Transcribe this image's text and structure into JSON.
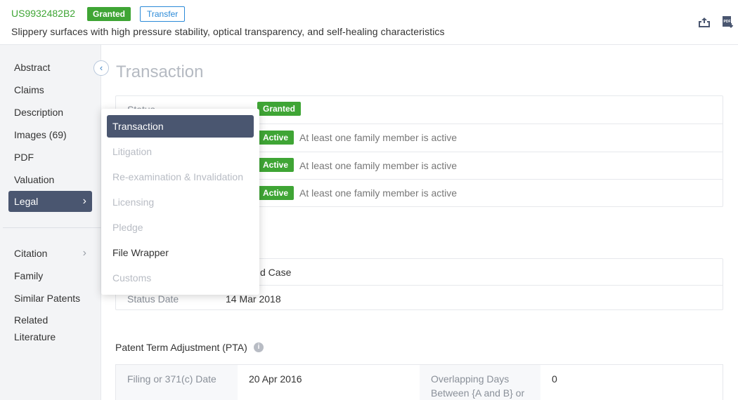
{
  "header": {
    "patent_number": "US9932482B2",
    "status_badge": "Granted",
    "transfer_badge": "Transfer",
    "title": "Slippery surfaces with high pressure stability, optical transparency, and self-healing characteristics",
    "icons": [
      "export-icon",
      "pdf-download-icon"
    ]
  },
  "sidebar": {
    "items": [
      {
        "label": "Abstract"
      },
      {
        "label": "Claims"
      },
      {
        "label": "Description"
      },
      {
        "label": "Images (69)"
      },
      {
        "label": "PDF"
      },
      {
        "label": "Valuation"
      },
      {
        "label": "Legal",
        "active": true
      },
      {
        "label": "Citation"
      },
      {
        "label": "Family"
      },
      {
        "label": "Similar Patents"
      },
      {
        "label": "Related Literature"
      }
    ]
  },
  "dropdown": {
    "items": [
      {
        "label": "Transaction",
        "state": "active"
      },
      {
        "label": "Litigation",
        "state": "disabled"
      },
      {
        "label": "Re-examination & Invalidation",
        "state": "disabled"
      },
      {
        "label": "Licensing",
        "state": "disabled"
      },
      {
        "label": "Pledge",
        "state": "disabled"
      },
      {
        "label": "File Wrapper",
        "state": "enabled"
      },
      {
        "label": "Customs",
        "state": "disabled"
      }
    ]
  },
  "main": {
    "title": "Transaction",
    "status_card": {
      "status_label": "Status",
      "status_badge": "Granted",
      "rows": [
        {
          "badge": "Active",
          "text": "At least one family member is active"
        },
        {
          "badge": "Active",
          "text": "At least one family member is active"
        },
        {
          "badge": "Active",
          "text": "At least one family member is active"
        }
      ]
    },
    "case_card": {
      "case_value": "d Case",
      "status_date_label": "Status Date",
      "status_date_value": "14 Mar 2018"
    },
    "pta": {
      "title": "Patent Term Adjustment (PTA)",
      "filing_label": "Filing or 371(c) Date",
      "filing_value": "20 Apr 2016",
      "overlap_label": "Overlapping Days Between {A and B} or",
      "overlap_value": "0"
    }
  },
  "colors": {
    "accent_green": "#3fa535",
    "accent_blue": "#2b8ad8",
    "active_nav": "#4a5670"
  }
}
